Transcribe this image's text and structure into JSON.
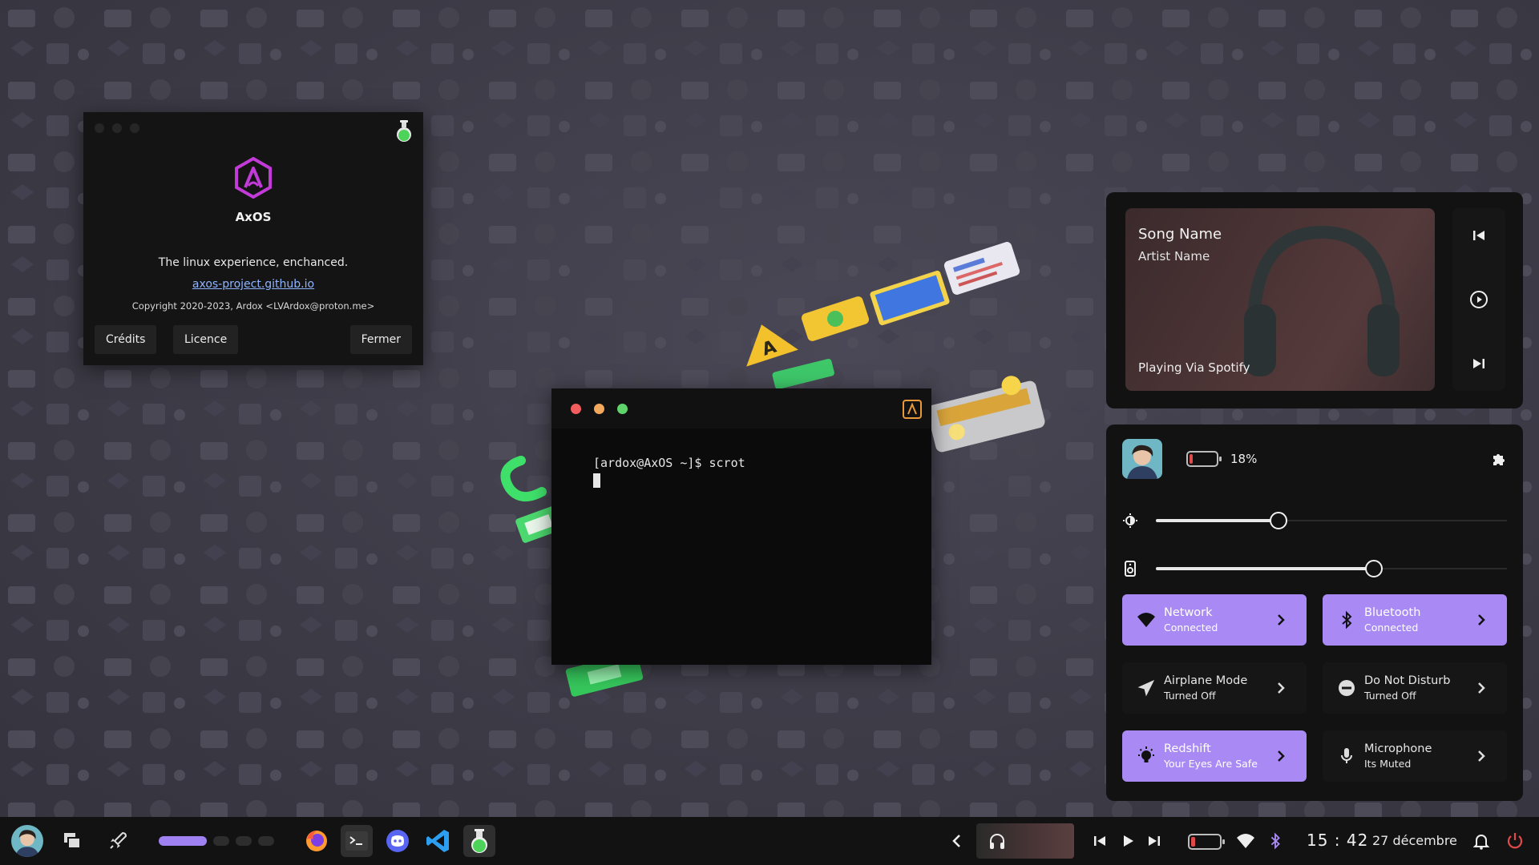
{
  "about_dialog": {
    "app_name": "AxOS",
    "tagline": "The linux experience, enchanced.",
    "link": "axos-project.github.io",
    "copyright": "Copyright 2020-2023, Ardox <LVArdox@proton.me>",
    "buttons": {
      "credits": "Crédits",
      "license": "Licence",
      "close": "Fermer"
    },
    "title_icon": "flask-icon",
    "logo_icon": "axos-logo-icon"
  },
  "terminal": {
    "prompt": "[ardox@AxOS ~]$ scrot",
    "title_icon": "axos-logo-icon"
  },
  "media": {
    "song": "Song Name",
    "artist": "Artist Name",
    "source": "Playing Via Spotify",
    "controls": [
      "previous-icon",
      "play-icon",
      "next-icon"
    ]
  },
  "quick_settings": {
    "battery_percent": "18%",
    "battery_level": 0.18,
    "brightness_level": 0.35,
    "volume_level": 0.62,
    "tiles": [
      {
        "name": "Network",
        "status": "Connected",
        "active": true,
        "icon": "wifi-icon"
      },
      {
        "name": "Bluetooth",
        "status": "Connected",
        "active": true,
        "icon": "bluetooth-icon"
      },
      {
        "name": "Airplane Mode",
        "status": "Turned Off",
        "active": false,
        "icon": "airplane-icon"
      },
      {
        "name": "Do Not Disturb",
        "status": "Turned Off",
        "active": false,
        "icon": "do-not-disturb-icon"
      },
      {
        "name": "Redshift",
        "status": "Your Eyes Are Safe",
        "active": true,
        "icon": "lightbulb-icon"
      },
      {
        "name": "Microphone",
        "status": "Its Muted",
        "active": false,
        "icon": "microphone-icon"
      }
    ]
  },
  "taskbar": {
    "apps": [
      "firefox-icon",
      "terminal-icon",
      "discord-icon",
      "vscode-icon",
      "flask-icon"
    ],
    "workspaces": 4,
    "active_workspace": 1,
    "battery_level": 0.18,
    "time": "15 : 42",
    "date": "27 décembre"
  },
  "colors": {
    "accent": "#a98af5",
    "battery_low": "#e14a4a",
    "panel": "#121212"
  }
}
